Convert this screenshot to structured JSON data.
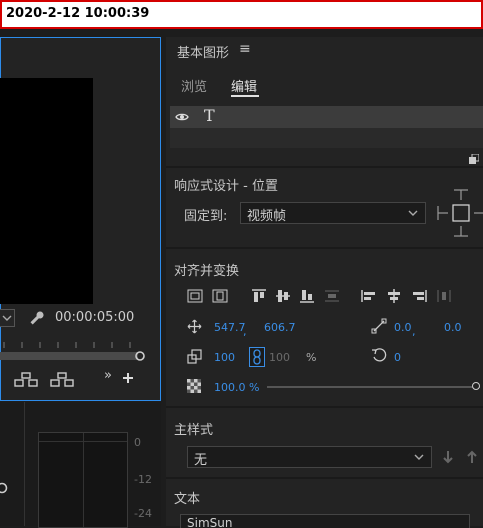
{
  "window": {
    "title": "2020-2-12 10:00:39"
  },
  "monitor": {
    "timecode": "00:00:05:00"
  },
  "audio_meter": {
    "ticks": [
      "0",
      "-12",
      "-24"
    ]
  },
  "essential_graphics": {
    "title": "基本图形",
    "menu_glyph": "≡",
    "tabs": [
      {
        "label": "浏览",
        "active": false
      },
      {
        "label": "编辑",
        "active": true
      }
    ],
    "layer": {
      "type_glyph": "T"
    },
    "responsive": {
      "heading": "响应式设计 - 位置",
      "pin_label": "固定到:",
      "pin_value": "视频帧"
    },
    "align": {
      "heading": "对齐并变换",
      "position_x": "547.7",
      "position_sep": ",",
      "position_y": "606.7",
      "anchor_x": "0.0",
      "anchor_sep": ",",
      "anchor_y": "0.0",
      "scale_w": "100",
      "scale_h": "100",
      "percent": "%",
      "rotation": "0",
      "opacity": "100.0 %",
      "opacity_level": 1.0
    },
    "master_style": {
      "heading": "主样式",
      "value": "无"
    },
    "text": {
      "heading": "文本",
      "font": "SimSun"
    }
  },
  "colors": {
    "accent": "#2d8ceb",
    "value_blue": "#3a8ee6",
    "title_border": "#d40000"
  }
}
